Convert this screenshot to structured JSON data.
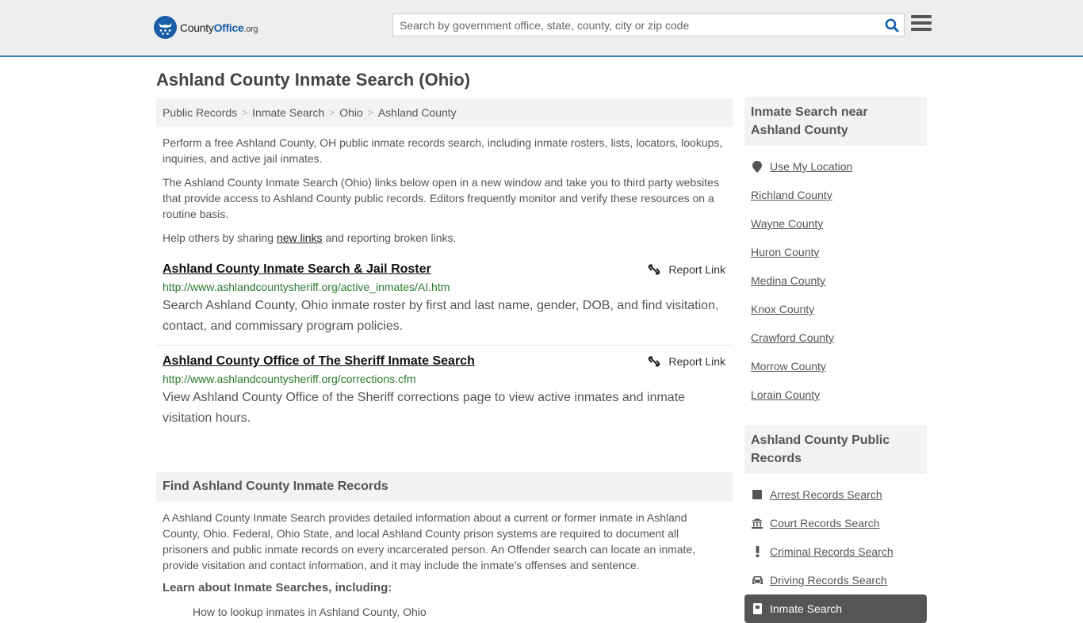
{
  "header": {
    "logo": {
      "part1": "County",
      "part2": "Office",
      "part3": ".org"
    },
    "search_placeholder": "Search by government office, state, county, city or zip code",
    "search_value": "",
    "icons": {
      "search": "search-icon",
      "menu": "hamburger-menu-icon"
    }
  },
  "page_title": "Ashland County Inmate Search (Ohio)",
  "breadcrumb": [
    "Public Records",
    "Inmate Search",
    "Ohio",
    "Ashland County"
  ],
  "intro": {
    "p1": "Perform a free Ashland County, OH public inmate records search, including inmate rosters, lists, locators, lookups, inquiries, and active jail inmates.",
    "p2": "The Ashland County Inmate Search (Ohio) links below open in a new window and take you to third party websites that provide access to Ashland County public records. Editors frequently monitor and verify these resources on a routine basis.",
    "p3_before": "Help others by sharing ",
    "p3_link": "new links",
    "p3_after": " and reporting broken links."
  },
  "links": [
    {
      "title": "Ashland County Inmate Search & Jail Roster",
      "url": "http://www.ashlandcountysheriff.org/active_inmates/AI.htm",
      "description": "Search Ashland County, Ohio inmate roster by first and last name, gender, DOB, and find visitation, contact, and commissary program policies.",
      "report_label": "Report Link"
    },
    {
      "title": "Ashland County Office of The Sheriff Inmate Search",
      "url": "http://www.ashlandcountysheriff.org/corrections.cfm",
      "description": "View Ashland County Office of the Sheriff corrections page to view active inmates and inmate visitation hours.",
      "report_label": "Report Link"
    }
  ],
  "find_section": {
    "heading": "Find Ashland County Inmate Records",
    "body": "A Ashland County Inmate Search provides detailed information about a current or former inmate in Ashland County, Ohio. Federal, Ohio State, and local Ashland County prison systems are required to document all prisoners and public inmate records on every incarcerated person. An Offender search can locate an inmate, provide visitation and contact information, and it may include the inmate's offenses and sentence.",
    "subheading": "Learn about Inmate Searches, including:",
    "bullets": [
      "How to lookup inmates in Ashland County, Ohio"
    ]
  },
  "sidebar": {
    "nearby": {
      "heading": "Inmate Search near Ashland County",
      "use_location": "Use My Location",
      "counties": [
        "Richland County",
        "Wayne County",
        "Huron County",
        "Medina County",
        "Knox County",
        "Crawford County",
        "Morrow County",
        "Lorain County"
      ]
    },
    "public_records": {
      "heading": "Ashland County Public Records",
      "items": [
        {
          "label": "Arrest Records Search",
          "icon": "square-icon",
          "active": false
        },
        {
          "label": "Court Records Search",
          "icon": "courthouse-icon",
          "active": false
        },
        {
          "label": "Criminal Records Search",
          "icon": "exclamation-icon",
          "active": false
        },
        {
          "label": "Driving Records Search",
          "icon": "car-icon",
          "active": false
        },
        {
          "label": "Inmate Search",
          "icon": "jail-door-icon",
          "active": true
        }
      ]
    }
  }
}
